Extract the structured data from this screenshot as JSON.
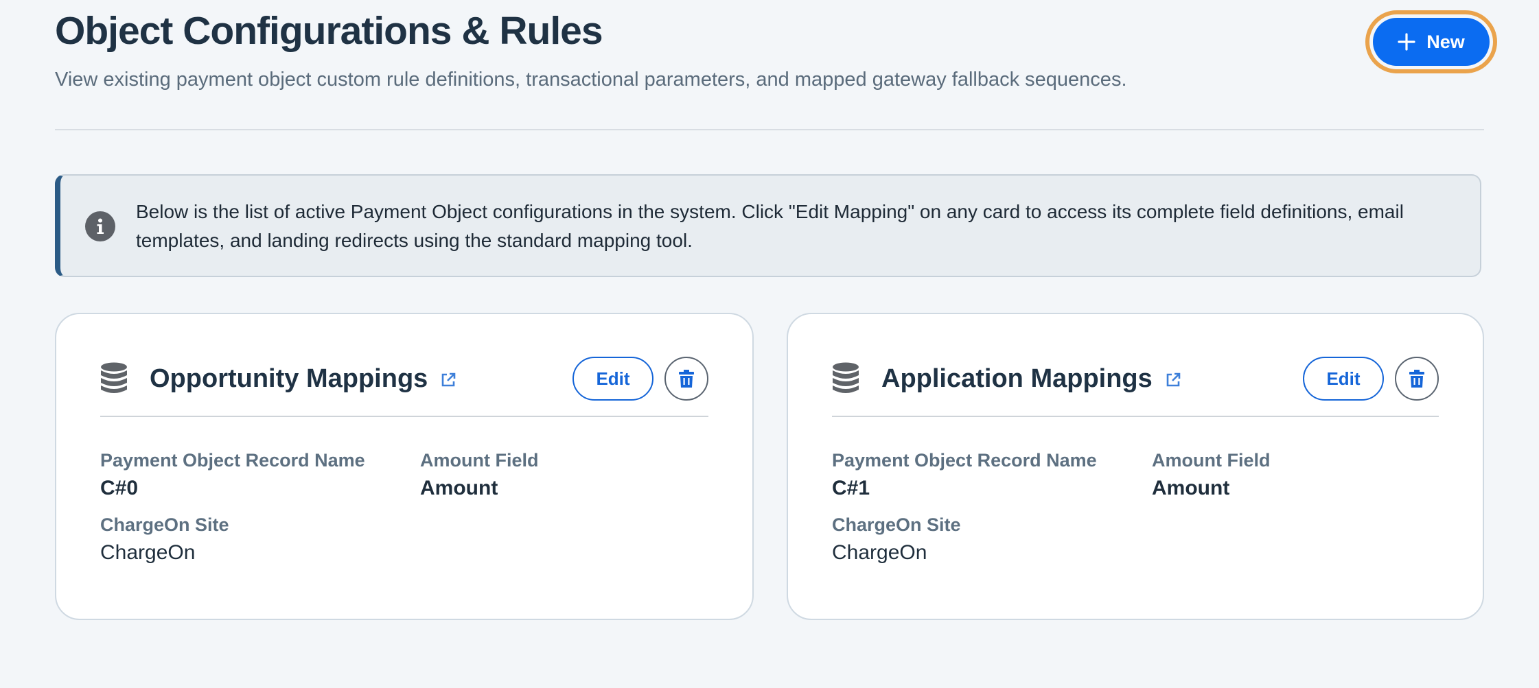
{
  "header": {
    "title": "Object Configurations & Rules",
    "subtitle": "View existing payment object custom rule definitions, transactional parameters, and mapped gateway fallback sequences.",
    "new_button_label": "New"
  },
  "info_banner": {
    "text": "Below is the list of active Payment Object configurations in the system. Click \"Edit Mapping\" on any card to access its complete field definitions, email templates, and landing redirects using the standard mapping tool."
  },
  "cards": [
    {
      "title": "Opportunity Mappings",
      "edit_label": "Edit",
      "record_name_label": "Payment Object Record Name",
      "record_name_value": "C#0",
      "amount_field_label": "Amount Field",
      "amount_field_value": "Amount",
      "site_label": "ChargeOn Site",
      "site_value": "ChargeOn"
    },
    {
      "title": "Application Mappings",
      "edit_label": "Edit",
      "record_name_label": "Payment Object Record Name",
      "record_name_value": "C#1",
      "amount_field_label": "Amount Field",
      "amount_field_value": "Amount",
      "site_label": "ChargeOn Site",
      "site_value": "ChargeOn"
    }
  ],
  "icons": {
    "new": "plus-icon",
    "info": "info-icon",
    "card": "database-icon",
    "title_link": "external-link-icon",
    "delete": "trash-icon"
  },
  "colors": {
    "primary": "#0b6cf1",
    "focus_ring": "#eaa34c",
    "banner_accent": "#2b5b86",
    "background": "#f3f6f9"
  }
}
